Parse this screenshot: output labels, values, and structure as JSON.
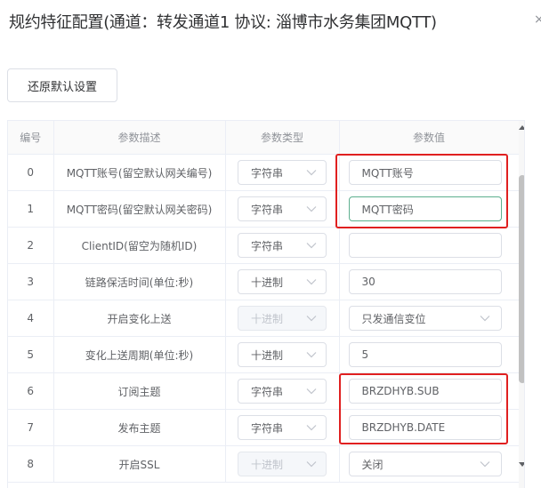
{
  "dialog": {
    "title": "规约特征配置(通道：转发通道1 协议: 淄博市水务集团MQTT)",
    "close_symbol": "×"
  },
  "toolbar": {
    "restore_label": "还原默认设置"
  },
  "table": {
    "headers": [
      "编号",
      "参数描述",
      "参数类型",
      "参数值"
    ],
    "rows": [
      {
        "no": "0",
        "desc": "MQTT账号(留空默认网关编号)",
        "type": "字符串",
        "type_disabled": false,
        "value": "MQTT账号",
        "value_kind": "input"
      },
      {
        "no": "1",
        "desc": "MQTT密码(留空默认网关密码)",
        "type": "字符串",
        "type_disabled": false,
        "value": "MQTT密码",
        "value_kind": "input-focus"
      },
      {
        "no": "2",
        "desc": "ClientID(留空为随机ID)",
        "type": "字符串",
        "type_disabled": false,
        "value": "",
        "value_kind": "input"
      },
      {
        "no": "3",
        "desc": "链路保活时间(单位:秒)",
        "type": "十进制",
        "type_disabled": false,
        "value": "30",
        "value_kind": "input"
      },
      {
        "no": "4",
        "desc": "开启变化上送",
        "type": "十进制",
        "type_disabled": true,
        "value": "只发通信变位",
        "value_kind": "select"
      },
      {
        "no": "5",
        "desc": "变化上送周期(单位:秒)",
        "type": "十进制",
        "type_disabled": false,
        "value": "5",
        "value_kind": "input"
      },
      {
        "no": "6",
        "desc": "订阅主题",
        "type": "字符串",
        "type_disabled": false,
        "value": "BRZDHYB.SUB",
        "value_kind": "input"
      },
      {
        "no": "7",
        "desc": "发布主题",
        "type": "字符串",
        "type_disabled": false,
        "value": "BRZDHYB.DATE",
        "value_kind": "input"
      },
      {
        "no": "8",
        "desc": "开启SSL",
        "type": "十进制",
        "type_disabled": true,
        "value": "关闭",
        "value_kind": "select"
      }
    ]
  },
  "colors": {
    "highlight": "#e02020",
    "focus_border": "#5daf8f",
    "border": "#dcdfe6"
  },
  "icons": {
    "select_arrow": "chevron-down-icon",
    "scroll_up": "scroll-up-arrow-icon",
    "scroll_down": "scroll-down-arrow-icon"
  }
}
